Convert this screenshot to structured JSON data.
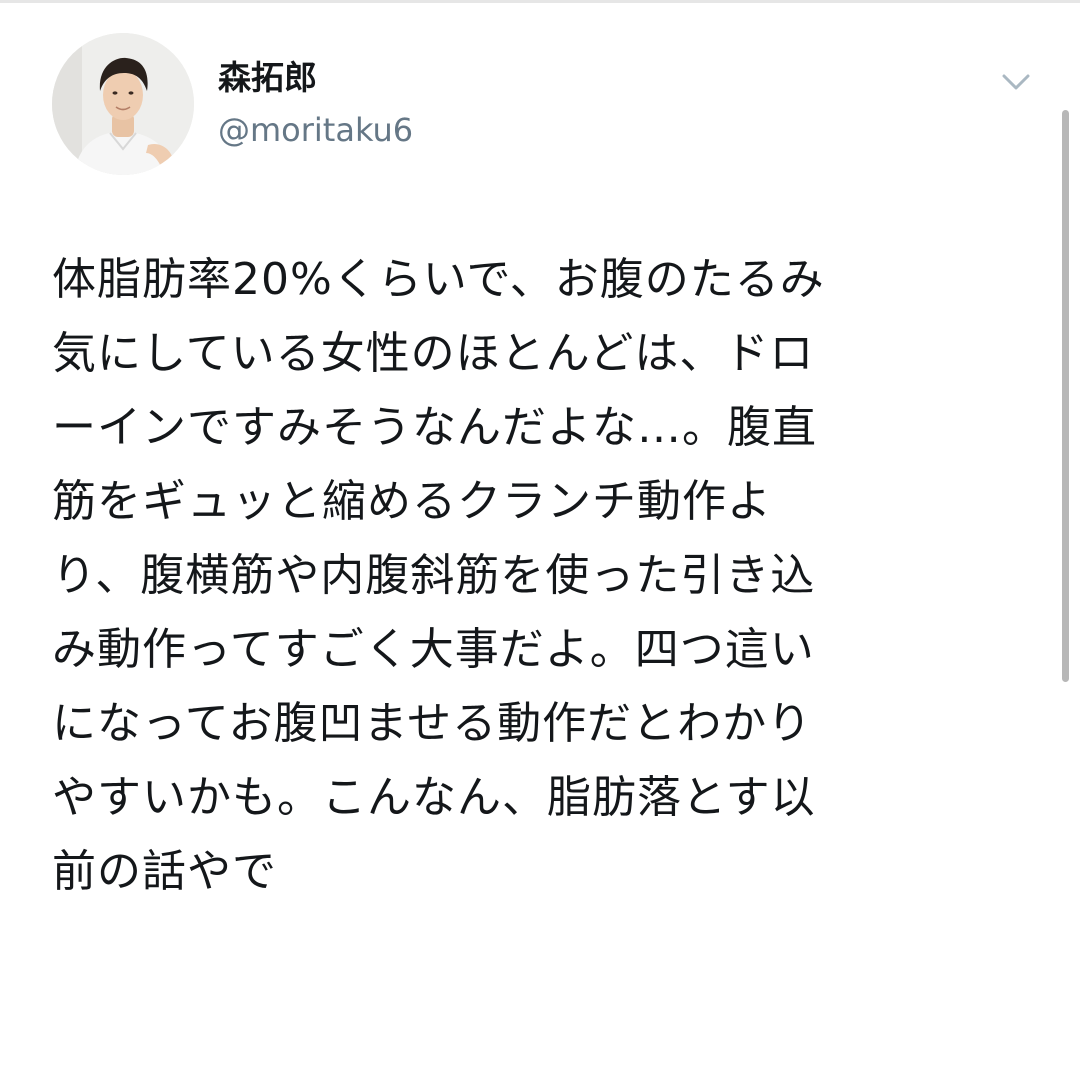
{
  "tweet": {
    "display_name": "森拓郎",
    "handle": "@moritaku6",
    "lines": [
      "体脂肪率20%くらいで、お腹のたるみ",
      "気にしている女性のほとんどは、ドロ",
      "ーインですみそうなんだよな…。腹直",
      "筋をギュッと縮めるクランチ動作よ",
      "り、腹横筋や内腹斜筋を使った引き込",
      "み動作ってすごく大事だよ。四つ這い",
      "になってお腹凹ませる動作だとわかり",
      "やすいかも。こんなん、脂肪落とす以",
      "前の話やで"
    ]
  },
  "icons": {
    "menu": "chevron-down-icon",
    "avatar": "avatar"
  },
  "colors": {
    "text": "#14171a",
    "secondary": "#657786",
    "chevron": "#aab8c2",
    "scrollbar": "#b7b7b7"
  }
}
